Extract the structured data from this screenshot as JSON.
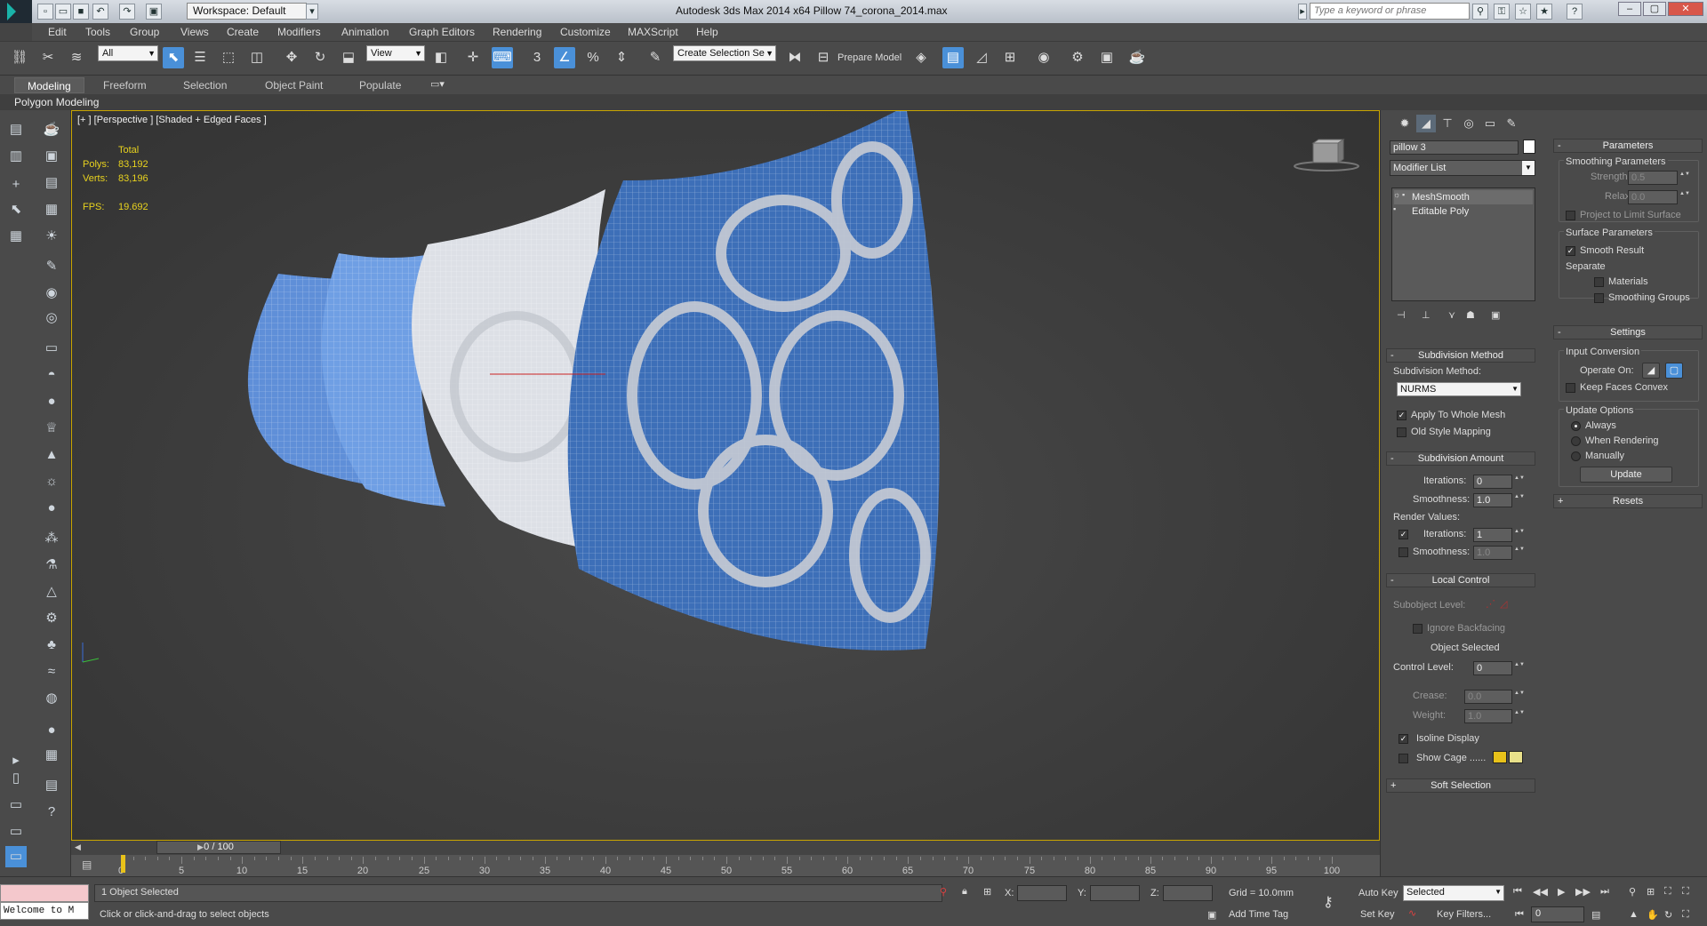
{
  "app": {
    "workspace": "Workspace: Default",
    "title": "Autodesk 3ds Max  2014 x64     Pillow 74_corona_2014.max",
    "search_placeholder": "Type a keyword or phrase"
  },
  "menu": [
    "Edit",
    "Tools",
    "Group",
    "Views",
    "Create",
    "Modifiers",
    "Animation",
    "Graph Editors",
    "Rendering",
    "Customize",
    "MAXScript",
    "Help"
  ],
  "toolbar": {
    "selection_filter": "All",
    "ref_coord": "View",
    "snap_label": "3",
    "named_selection": "Create Selection Se",
    "prepare_model": "Prepare Model"
  },
  "ribbon": {
    "tabs": [
      "Modeling",
      "Freeform",
      "Selection",
      "Object Paint",
      "Populate"
    ],
    "active_tab": "Modeling",
    "sub_label": "Polygon Modeling"
  },
  "viewport": {
    "label": "[+ ] [Perspective ] [Shaded + Edged Faces ]",
    "stats": {
      "header": "Total",
      "polys_label": "Polys:",
      "polys": "83,192",
      "verts_label": "Verts:",
      "verts": "83,196",
      "fps_label": "FPS:",
      "fps": "19.692"
    },
    "colors": {
      "frame": "#c9a500",
      "pillow_blue": "#3d6fb8",
      "pillow_light": "#8ab4e8",
      "pattern": "#c8ccd4",
      "grid_red": "#cc2222"
    }
  },
  "command_panel": {
    "object_name": "pillow 3",
    "modifier_list": "Modifier List",
    "stack": [
      "MeshSmooth",
      "Editable Poly"
    ],
    "subdivision_method": {
      "title": "Subdivision Method",
      "label": "Subdivision Method:",
      "value": "NURMS",
      "apply_whole_mesh": "Apply To Whole Mesh",
      "old_style": "Old Style Mapping"
    },
    "subdivision_amount": {
      "title": "Subdivision Amount",
      "iterations_label": "Iterations:",
      "iterations": "0",
      "smoothness_label": "Smoothness:",
      "smoothness": "1.0",
      "render_values": "Render Values:",
      "render_iterations": "1",
      "render_smoothness": "1.0"
    },
    "local_control": {
      "title": "Local Control",
      "subobject_level": "Subobject Level:",
      "ignore_backfacing": "Ignore Backfacing",
      "object_selected": "Object Selected",
      "control_level_label": "Control Level:",
      "control_level": "0",
      "crease_label": "Crease:",
      "crease": "0.0",
      "weight_label": "Weight:",
      "weight": "1.0",
      "isoline_display": "Isoline Display",
      "show_cage": "Show Cage ......",
      "cage_color_1": "#e8c21a",
      "cage_color_2": "#e8e08a"
    },
    "soft_selection": "Soft Selection",
    "parameters": {
      "title": "Parameters",
      "smoothing_parameters": "Smoothing Parameters",
      "strength_label": "Strength:",
      "strength": "0.5",
      "relax_label": "Relax:",
      "relax": "0.0",
      "project_limit": "Project to Limit Surface",
      "surface_parameters": "Surface Parameters",
      "smooth_result": "Smooth Result",
      "separate": "Separate",
      "materials": "Materials",
      "smoothing_groups": "Smoothing Groups"
    },
    "settings": {
      "title": "Settings",
      "input_conversion": "Input Conversion",
      "operate_on": "Operate On:",
      "keep_faces_convex": "Keep Faces Convex",
      "update_options": "Update Options",
      "always": "Always",
      "when_rendering": "When Rendering",
      "manually": "Manually",
      "update_button": "Update"
    },
    "resets": "Resets"
  },
  "timeline": {
    "slider": "0 / 100",
    "ticks": [
      "0",
      "5",
      "10",
      "15",
      "20",
      "25",
      "30",
      "35",
      "40",
      "45",
      "50",
      "55",
      "60",
      "65",
      "70",
      "75",
      "80",
      "85",
      "90",
      "95",
      "100"
    ]
  },
  "status": {
    "listener": "Welcome to M",
    "selected": "1 Object Selected",
    "prompt": "Click or click-and-drag to select objects",
    "x_label": "X:",
    "y_label": "Y:",
    "z_label": "Z:",
    "grid": "Grid = 10.0mm",
    "add_time_tag": "Add Time Tag",
    "auto_key": "Auto Key",
    "set_key": "Set Key",
    "key_mode": "Selected",
    "key_filters": "Key Filters...",
    "frame": "0"
  }
}
